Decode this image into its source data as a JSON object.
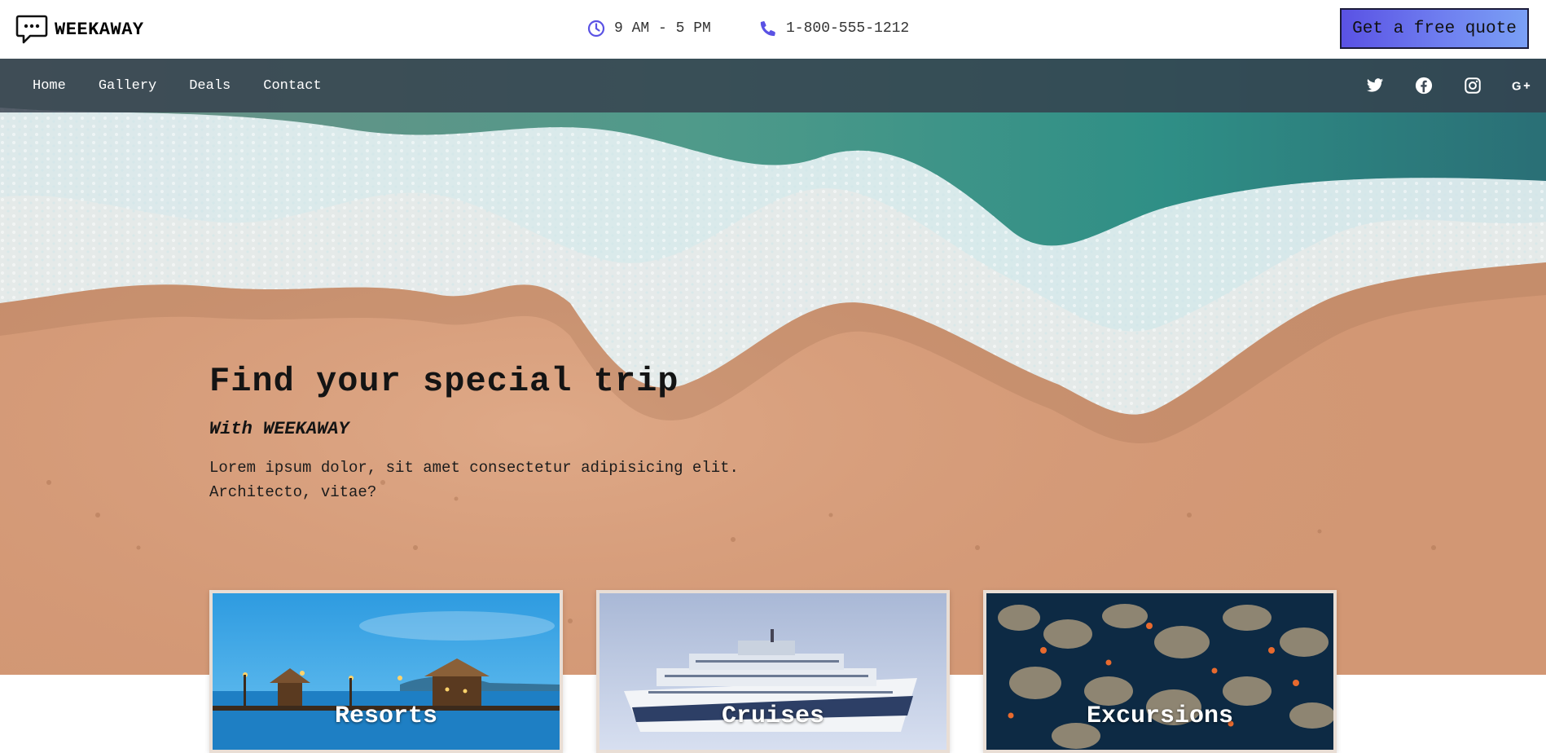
{
  "brand": {
    "name": "WEEKAWAY",
    "icon": "chat-bubble-icon"
  },
  "header": {
    "hours": {
      "icon": "clock-icon",
      "text": "9 AM - 5 PM"
    },
    "phone": {
      "icon": "phone-icon",
      "text": "1-800-555-1212"
    },
    "cta_label": "Get a free quote"
  },
  "nav": {
    "links": [
      {
        "label": "Home"
      },
      {
        "label": "Gallery"
      },
      {
        "label": "Deals"
      },
      {
        "label": "Contact"
      }
    ],
    "social": [
      {
        "icon": "twitter-icon"
      },
      {
        "icon": "facebook-icon"
      },
      {
        "icon": "instagram-icon"
      },
      {
        "icon": "google-plus-icon"
      }
    ]
  },
  "hero": {
    "title": "Find your special trip",
    "subtitle": "With WEEKAWAY",
    "description": "Lorem ipsum dolor, sit amet consectetur adipisicing elit. Architecto, vitae?"
  },
  "cards": [
    {
      "label": "Resorts"
    },
    {
      "label": "Cruises"
    },
    {
      "label": "Excursions"
    }
  ],
  "colors": {
    "accent": "#5a52e4",
    "nav_bg": "#343e4c",
    "sand": "#d49877",
    "sea": "#2f8f86"
  }
}
